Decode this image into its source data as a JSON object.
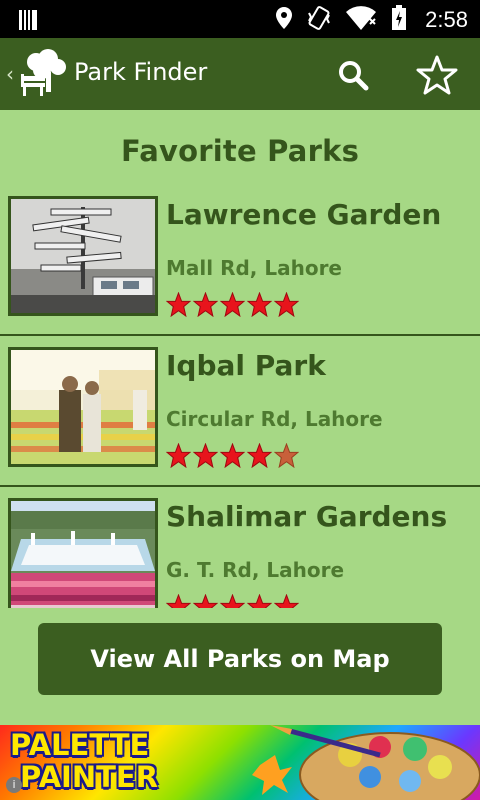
{
  "status_bar": {
    "time": "2:58",
    "icons": [
      "sd-card-icon",
      "location-icon",
      "vibrate-icon",
      "wifi-icon",
      "battery-icon"
    ]
  },
  "action_bar": {
    "title": "Park Finder",
    "icons": [
      "up-arrow-icon",
      "park-bench-icon",
      "search-icon",
      "star-outline-icon"
    ]
  },
  "page": {
    "title": "Favorite Parks"
  },
  "parks": [
    {
      "name": "Lawrence Garden",
      "address": "Mall Rd, Lahore",
      "rating": 5
    },
    {
      "name": "Iqbal Park",
      "address": "Circular Rd, Lahore",
      "rating": 4
    },
    {
      "name": "Shalimar Gardens",
      "address": "G. T. Rd, Lahore",
      "rating": 5
    }
  ],
  "map_button": {
    "label": "View All Parks on Map"
  },
  "ad": {
    "line1": "PALETTE",
    "line2": "PAINTER",
    "info": "i"
  },
  "colors": {
    "action_bar": "#3b5e20",
    "background": "#a6d885",
    "text_dark_green": "#35551c",
    "text_medium_green": "#4e7a30",
    "star_filled": "#e8141c",
    "star_empty": "#c8603a"
  }
}
